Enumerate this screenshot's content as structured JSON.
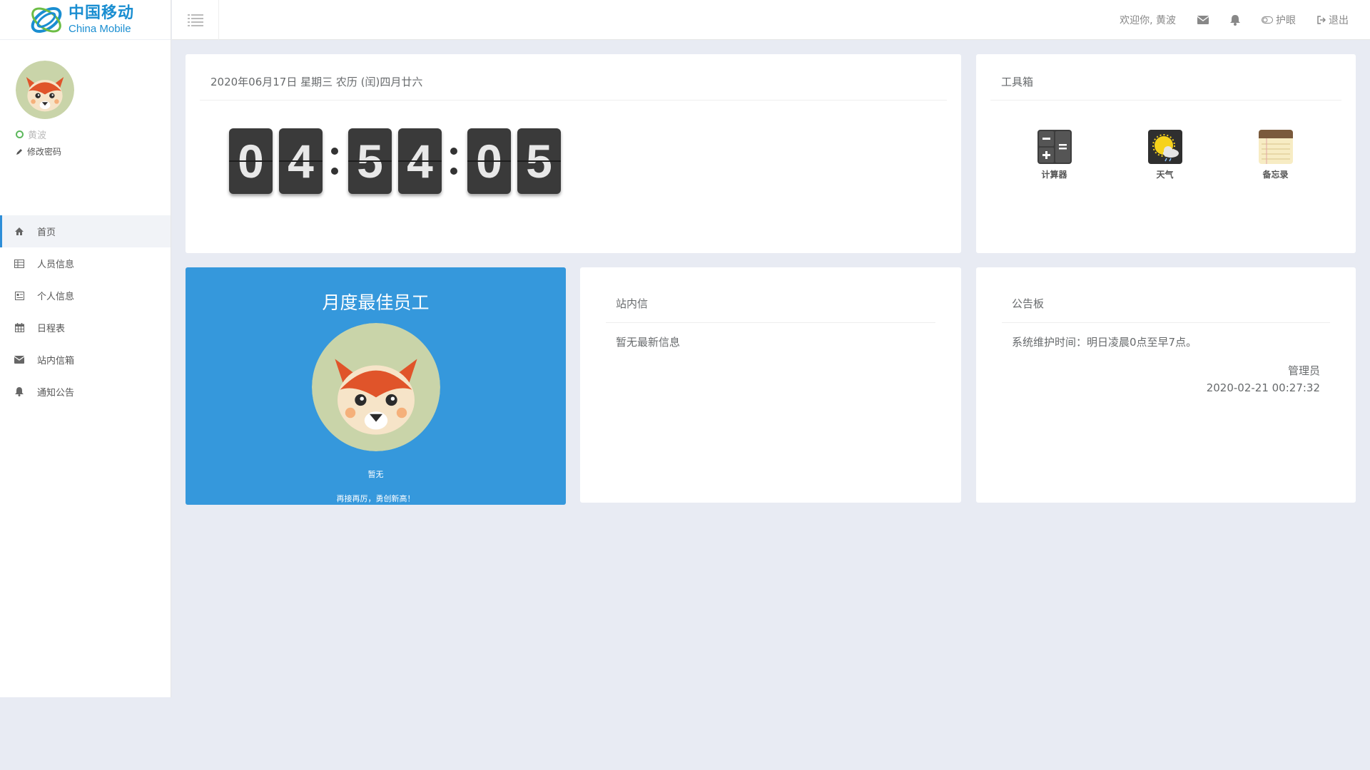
{
  "logo": {
    "name_cn": "中国移动",
    "name_en": "China Mobile"
  },
  "profile": {
    "user_name": "黄波",
    "change_password": "修改密码"
  },
  "sidebar": {
    "items": [
      {
        "label": "首页",
        "icon": "home-icon",
        "active": true
      },
      {
        "label": "人员信息",
        "icon": "table-icon"
      },
      {
        "label": "个人信息",
        "icon": "id-card-icon"
      },
      {
        "label": "日程表",
        "icon": "calendar-icon"
      },
      {
        "label": "站内信箱",
        "icon": "envelope-icon"
      },
      {
        "label": "通知公告",
        "icon": "bell-icon"
      }
    ]
  },
  "topbar": {
    "welcome": "欢迎你, 黄波",
    "eye_care": "护眼",
    "logout": "退出"
  },
  "date_card": {
    "date_text": "2020年06月17日 星期三 农历 (闰)四月廿六",
    "clock": {
      "h1": "0",
      "h2": "4",
      "m1": "5",
      "m2": "4",
      "s1": "0",
      "s2": "5"
    }
  },
  "toolbox": {
    "title": "工具箱",
    "tools": [
      {
        "label": "计算器",
        "icon": "calculator-icon"
      },
      {
        "label": "天气",
        "icon": "weather-icon"
      },
      {
        "label": "备忘录",
        "icon": "notepad-icon"
      }
    ]
  },
  "employee_card": {
    "title": "月度最佳员工",
    "name": "暂无",
    "slogan": "再接再厉，勇创新高！"
  },
  "messages_card": {
    "title": "站内信",
    "empty_text": "暂无最新信息"
  },
  "notice_card": {
    "title": "公告板",
    "text": "系统维护时间：明日凌晨0点至早7点。",
    "author": "管理员",
    "time": "2020-02-21 00:27:32"
  },
  "colors": {
    "accent": "#3598dc",
    "brand": "#1a8ed1",
    "background": "#e8ebf3",
    "status_online": "#5cb85c"
  }
}
